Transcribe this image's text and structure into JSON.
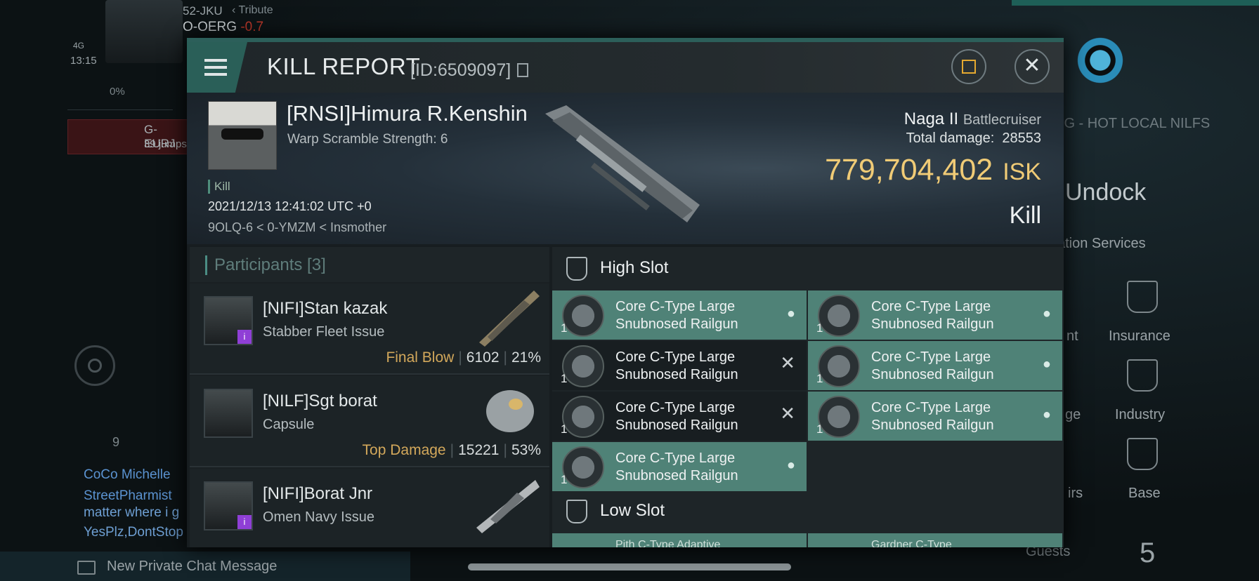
{
  "background": {
    "system": "52-JKU",
    "tribute": "Tribute",
    "security_name": "O-OERG",
    "security_value": "-0.7",
    "signal": "4G",
    "clock": "13:15",
    "cargo_percent": "0%",
    "route_dest": "G-EURJ",
    "route_jumps": "39 jumps",
    "chat_member_count": "9",
    "chat_lines": [
      "CoCo Michelle",
      "StreetPharmist",
      "matter where i g",
      "YesPlz,DontStop"
    ],
    "private_chat": "New Private Chat Message",
    "local_channel": "RG - HOT LOCAL NILFS",
    "undock": "Undock",
    "station_services": "ation Services",
    "services": {
      "insurance": "Insurance",
      "industry": "Industry",
      "base": "Base",
      "partial1": "nt",
      "partial2": "ge",
      "partial3": "irs"
    },
    "guests_label": "Guests",
    "guests_count": "5"
  },
  "report": {
    "title": "KILL REPORT",
    "id": "[ID:6509097]",
    "victim_name": "[RNSI]Himura R.Kenshin",
    "warp_scramble": "Warp Scramble Strength: 6",
    "kill_tag": "Kill",
    "datetime": "2021/12/13 12:41:02 UTC +0",
    "location": "9OLQ-6 < 0-YMZM < Insmother",
    "ship_name": "Naga II",
    "ship_class": "Battlecruiser",
    "total_damage_label": "Total damage:",
    "total_damage": "28553",
    "isk_value": "779,704,402",
    "isk_unit": "ISK",
    "result": "Kill"
  },
  "participants": {
    "header": "Participants [3]",
    "rows": [
      {
        "name": "[NIFI]Stan kazak",
        "ship": "Stabber Fleet Issue",
        "label": "Final Blow",
        "damage": "6102",
        "percent": "21%"
      },
      {
        "name": "[NILF]Sgt borat",
        "ship": "Capsule",
        "label": "Top Damage",
        "damage": "15221",
        "percent": "53%"
      },
      {
        "name": "[NIFI]Borat Jnr",
        "ship": "Omen Navy Issue",
        "label": "",
        "damage": "",
        "percent": ""
      }
    ]
  },
  "slots": {
    "high_label": "High Slot",
    "low_label": "Low Slot",
    "module_name": "Core C-Type Large Snubnosed Railgun",
    "low_partial_1": "Pith C-Type Adaptive",
    "low_partial_2": "Gardner C-Type"
  },
  "colors": {
    "accent": "#4f8277",
    "isk": "#f0cb76",
    "final_blow": "#d3a85b",
    "header_bar": "#2c5f5a"
  }
}
